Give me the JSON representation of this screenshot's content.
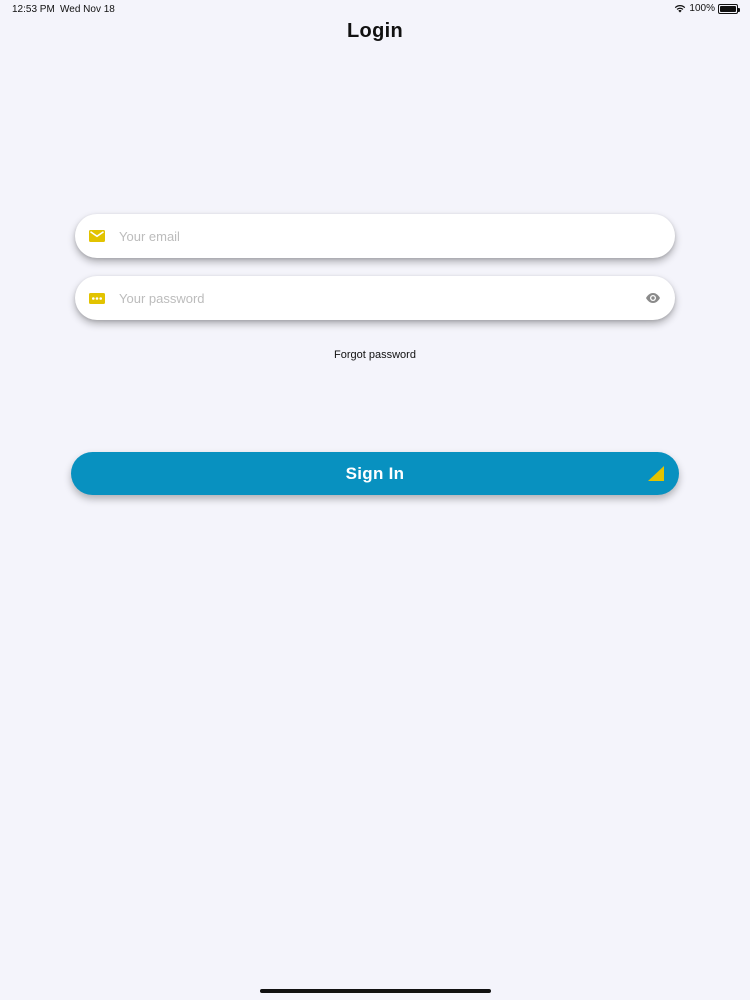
{
  "status_bar": {
    "time": "12:53 PM",
    "date": "Wed Nov 18",
    "battery": "100%"
  },
  "page": {
    "title": "Login"
  },
  "email_field": {
    "value": "",
    "placeholder": "Your email",
    "icon": "mail-icon"
  },
  "password_field": {
    "value": "",
    "placeholder": "Your password",
    "icon": "password-dots-icon",
    "toggle_icon": "eye-icon"
  },
  "forgot_password": {
    "label": "Forgot password"
  },
  "sign_in": {
    "label": "Sign In",
    "icon": "triangle-corner-icon"
  },
  "colors": {
    "background": "#f4f4fb",
    "accent": "#0891c0",
    "icon_yellow": "#e2c300",
    "field_bg": "#ffffff"
  }
}
